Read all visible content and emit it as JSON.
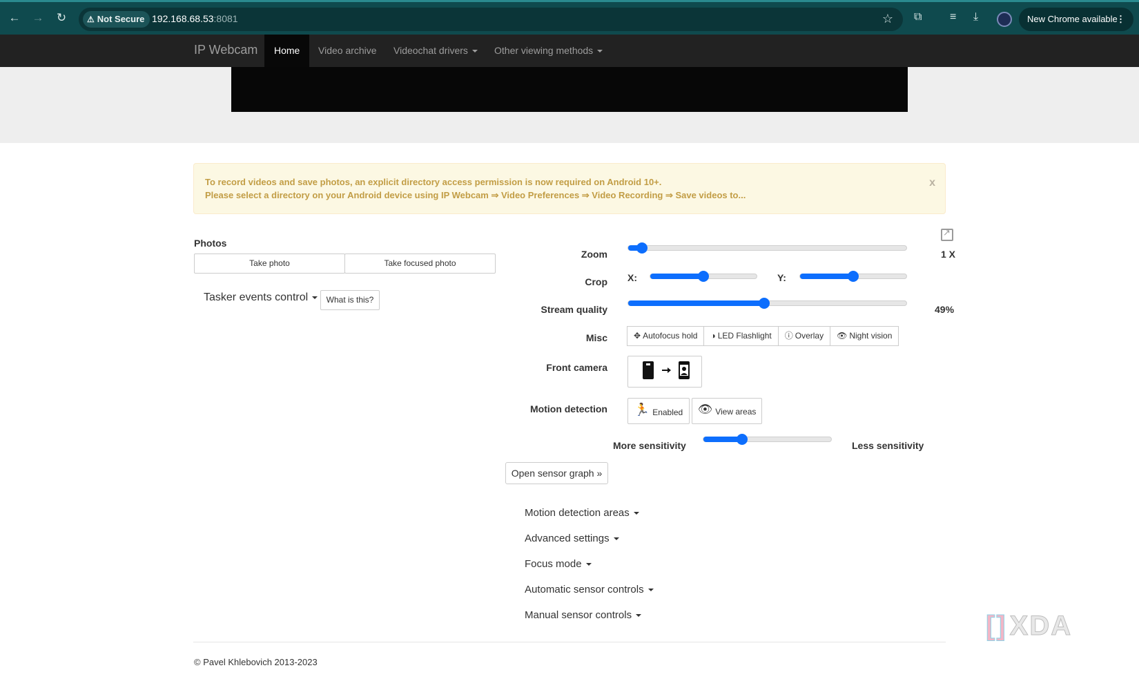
{
  "browser": {
    "security_label": "Not Secure",
    "url_host": "192.168.68.53",
    "url_port": ":8081",
    "update_label": "New Chrome available"
  },
  "navbar": {
    "brand": "IP Webcam",
    "items": [
      {
        "label": "Home",
        "active": true
      },
      {
        "label": "Video archive"
      },
      {
        "label": "Videochat drivers"
      },
      {
        "label": "Other viewing methods"
      }
    ]
  },
  "alert": {
    "line1": "To record videos and save photos, an explicit directory access permission is now required on Android 10+.",
    "line2": "Please select a directory on your Android device using IP Webcam ⇒ Video Preferences ⇒ Video Recording ⇒ Save videos to...",
    "close": "x"
  },
  "photos": {
    "label": "Photos",
    "take_photo": "Take photo",
    "take_focused": "Take focused photo"
  },
  "tasker": {
    "label": "Tasker events control",
    "what_is_this": "What is this?"
  },
  "controls": {
    "zoom": {
      "label": "Zoom",
      "value": "1 X",
      "level": 0.05
    },
    "crop": {
      "label": "Crop",
      "x_label": "X:",
      "y_label": "Y:",
      "x_level": 0.5,
      "y_level": 0.5
    },
    "stream_quality": {
      "label": "Stream quality",
      "value": "49%",
      "level": 0.49
    },
    "misc": {
      "label": "Misc",
      "buttons": [
        {
          "label": "Autofocus hold",
          "icon": "crosshair-icon",
          "glyph": "✥"
        },
        {
          "label": "LED Flashlight",
          "icon": "contrast-icon",
          "glyph": "◑"
        },
        {
          "label": "Overlay",
          "icon": "info-icon",
          "glyph": "ⓘ"
        },
        {
          "label": "Night vision",
          "icon": "eye-icon",
          "glyph": "👁"
        }
      ]
    },
    "front_camera": {
      "label": "Front camera"
    },
    "motion": {
      "label": "Motion detection",
      "enabled": "Enabled",
      "view_areas": "View areas",
      "more_sensitivity": "More sensitivity",
      "less_sensitivity": "Less sensitivity",
      "level": 0.3
    },
    "sensor_graph": "Open sensor graph »"
  },
  "sections": [
    "Motion detection areas",
    "Advanced settings",
    "Focus mode",
    "Automatic sensor controls",
    "Manual sensor controls"
  ],
  "footer": "© Pavel Khlebovich 2013-2023",
  "watermark": "XDA"
}
